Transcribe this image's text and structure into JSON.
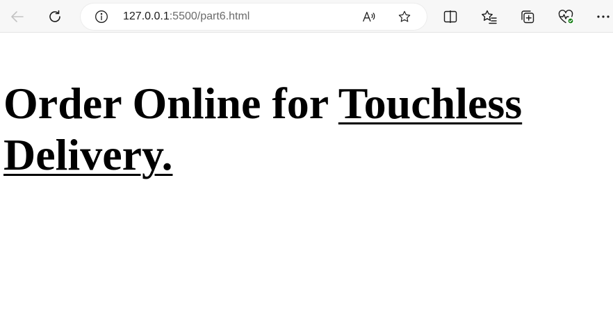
{
  "browser": {
    "url_host": "127.0.0.1",
    "url_rest": ":5500/part6.html",
    "icons": {
      "back": "back-arrow-icon",
      "refresh": "refresh-icon",
      "site_info": "info-icon",
      "read_aloud": "read-aloud-icon",
      "favorite": "star-icon",
      "split_screen": "split-screen-icon",
      "favorites": "favorites-icon",
      "collections": "collections-icon",
      "browser_essentials": "heartbeat-icon",
      "more": "more-icon"
    },
    "colors": {
      "toolbar_bg": "#f7f7f7",
      "icon": "#1b1b1b",
      "disabled_icon": "#c3c3c3",
      "status_green": "#107c10"
    }
  },
  "page": {
    "heading_text": "Order Online for ",
    "heading_link": "Touchless Delivery."
  }
}
